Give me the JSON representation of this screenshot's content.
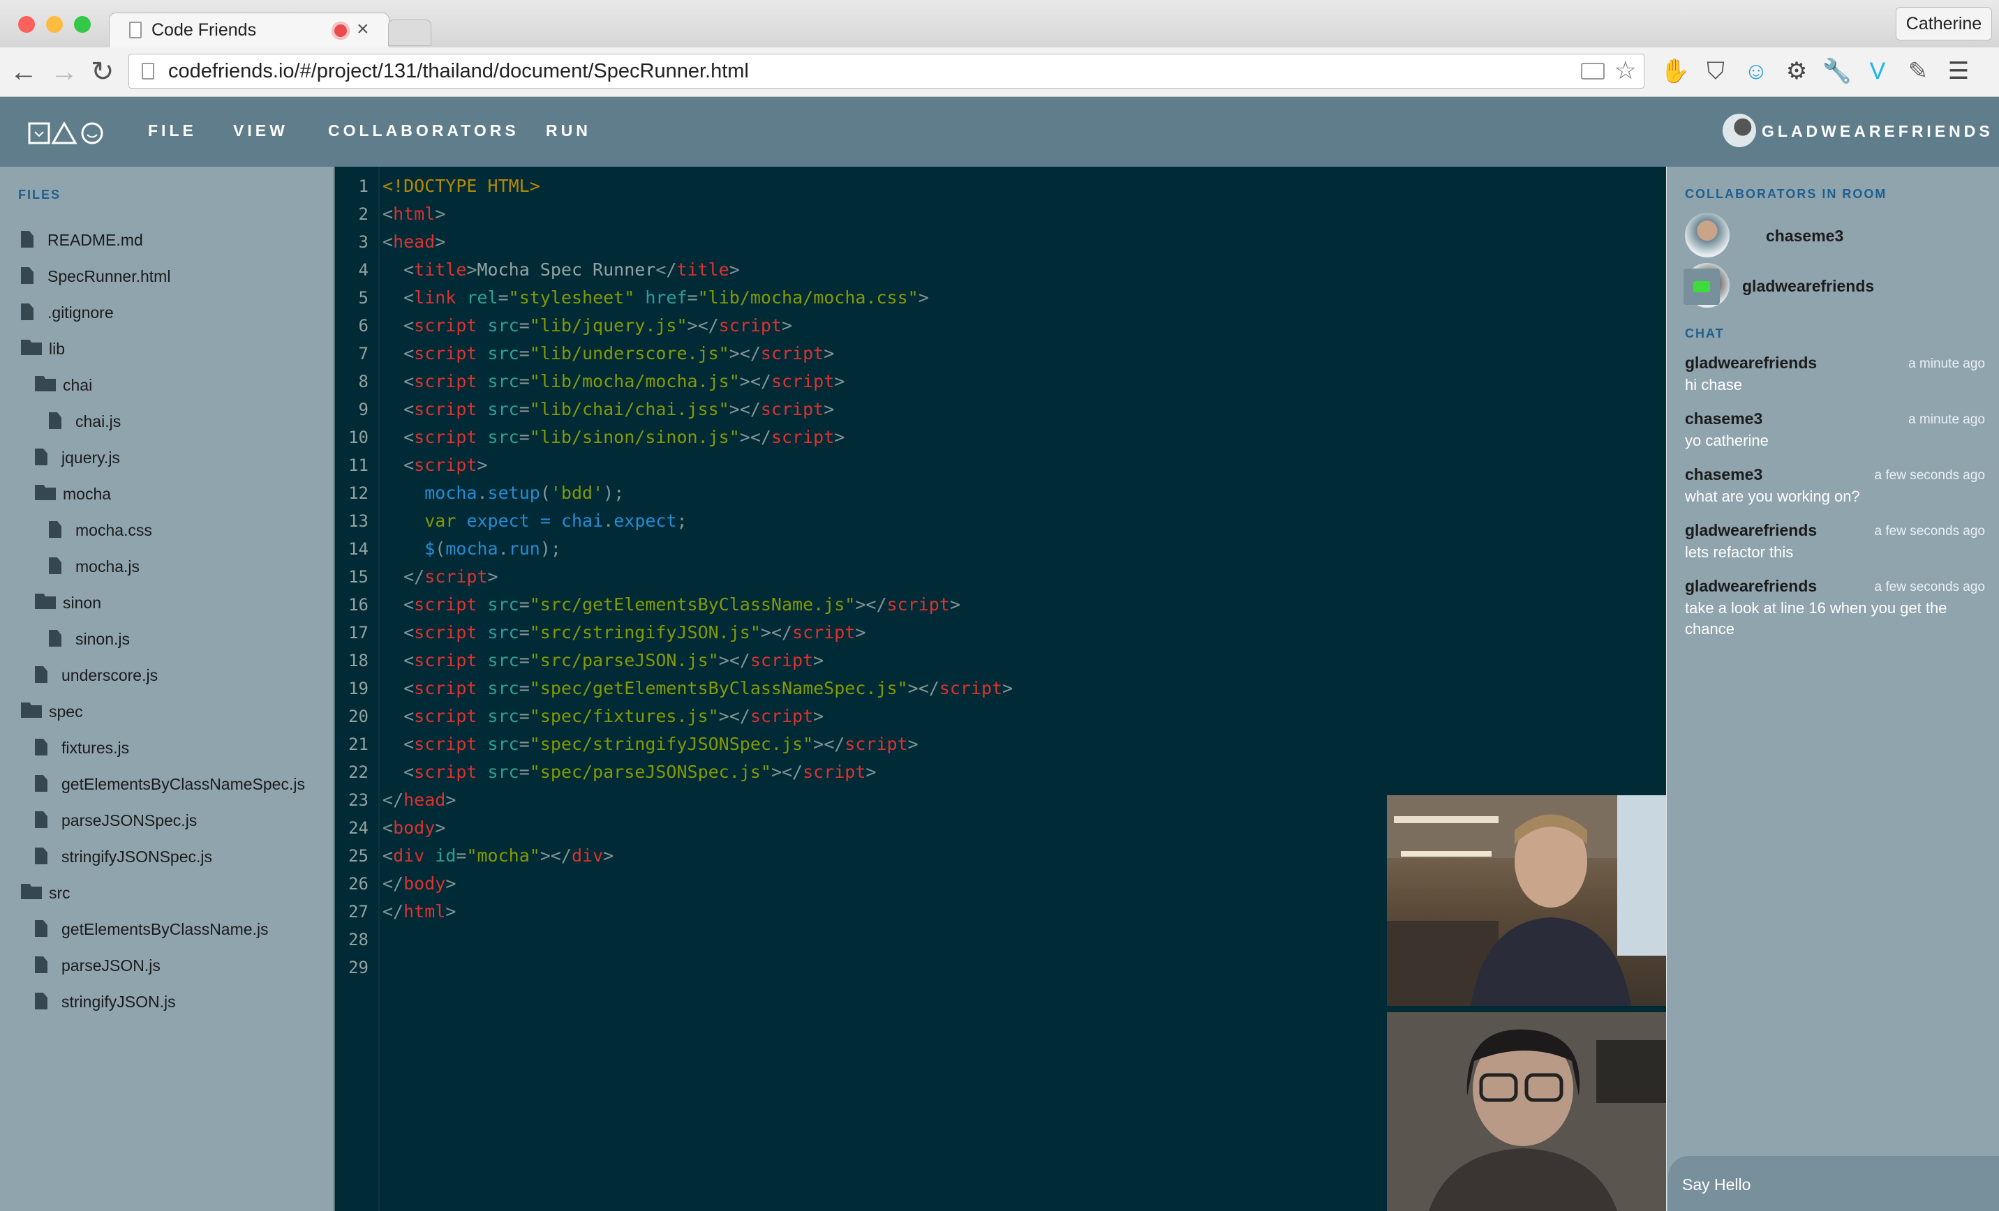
{
  "browser": {
    "tab_title": "Code Friends",
    "profile_name": "Catherine",
    "url": "codefriends.io/#/project/131/thailand/document/SpecRunner.html",
    "traffic_lights": [
      "#fc605c",
      "#fdbc40",
      "#34c84a"
    ],
    "nav_icons": [
      "back-arrow-icon",
      "forward-arrow-icon",
      "reload-icon"
    ],
    "extensions": [
      {
        "name": "adblock-icon",
        "glyph": "✋",
        "color": "#d8302c"
      },
      {
        "name": "pocket-icon",
        "glyph": "⛉",
        "color": "#555"
      },
      {
        "name": "ghost-icon",
        "glyph": "☺",
        "color": "#2e9bdc"
      },
      {
        "name": "settings-gear-icon",
        "glyph": "⚙",
        "color": "#444"
      },
      {
        "name": "wrench-icon",
        "glyph": "🔧",
        "color": "#444"
      },
      {
        "name": "vimeo-icon",
        "glyph": "V",
        "color": "#1ab7ea"
      },
      {
        "name": "eyedropper-icon",
        "glyph": "✎",
        "color": "#666"
      },
      {
        "name": "hamburger-menu-icon",
        "glyph": "☰",
        "color": "#444"
      }
    ]
  },
  "app": {
    "menu": [
      "FILE",
      "VIEW",
      "COLLABORATORS",
      "RUN"
    ],
    "user_name": "GLADWEAREFRIENDS",
    "accent": "#607d8b"
  },
  "files": {
    "header": "FILES",
    "items": [
      {
        "type": "file",
        "depth": 0,
        "name": "README.md"
      },
      {
        "type": "file",
        "depth": 0,
        "name": "SpecRunner.html"
      },
      {
        "type": "file",
        "depth": 0,
        "name": ".gitignore"
      },
      {
        "type": "folder",
        "depth": 0,
        "name": "lib"
      },
      {
        "type": "folder",
        "depth": 1,
        "name": "chai"
      },
      {
        "type": "file",
        "depth": 2,
        "name": "chai.js"
      },
      {
        "type": "file",
        "depth": 1,
        "name": "jquery.js"
      },
      {
        "type": "folder",
        "depth": 1,
        "name": "mocha"
      },
      {
        "type": "file",
        "depth": 2,
        "name": "mocha.css"
      },
      {
        "type": "file",
        "depth": 2,
        "name": "mocha.js"
      },
      {
        "type": "folder",
        "depth": 1,
        "name": "sinon"
      },
      {
        "type": "file",
        "depth": 2,
        "name": "sinon.js"
      },
      {
        "type": "file",
        "depth": 1,
        "name": "underscore.js"
      },
      {
        "type": "folder",
        "depth": 0,
        "name": "spec"
      },
      {
        "type": "file",
        "depth": 1,
        "name": "fixtures.js"
      },
      {
        "type": "file",
        "depth": 1,
        "name": "getElementsByClassNameSpec.js"
      },
      {
        "type": "file",
        "depth": 1,
        "name": "parseJSONSpec.js"
      },
      {
        "type": "file",
        "depth": 1,
        "name": "stringifyJSONSpec.js"
      },
      {
        "type": "folder",
        "depth": 0,
        "name": "src"
      },
      {
        "type": "file",
        "depth": 1,
        "name": "getElementsByClassName.js"
      },
      {
        "type": "file",
        "depth": 1,
        "name": "parseJSON.js"
      },
      {
        "type": "file",
        "depth": 1,
        "name": "stringifyJSON.js"
      }
    ]
  },
  "editor": {
    "line_count": 29,
    "lines": [
      [
        [
          "dt",
          "<!DOCTYPE HTML>"
        ]
      ],
      [
        [
          "p",
          "<"
        ],
        [
          "tag",
          "html"
        ],
        [
          "p",
          ">"
        ]
      ],
      [
        [
          "p",
          "<"
        ],
        [
          "tag",
          "head"
        ],
        [
          "p",
          ">"
        ]
      ],
      [
        [
          "p",
          "  <"
        ],
        [
          "tag",
          "title"
        ],
        [
          "p",
          ">"
        ],
        [
          "txt",
          "Mocha Spec Runner"
        ],
        [
          "p",
          "</"
        ],
        [
          "tag",
          "title"
        ],
        [
          "p",
          ">"
        ]
      ],
      [
        [
          "p",
          "  <"
        ],
        [
          "tag",
          "link"
        ],
        [
          "p",
          " "
        ],
        [
          "attr",
          "rel"
        ],
        [
          "p",
          "="
        ],
        [
          "str",
          "\"stylesheet\""
        ],
        [
          "p",
          " "
        ],
        [
          "attr",
          "href"
        ],
        [
          "p",
          "="
        ],
        [
          "str",
          "\"lib/mocha/mocha.css\""
        ],
        [
          "p",
          ">"
        ]
      ],
      [
        [
          "p",
          "  <"
        ],
        [
          "tag",
          "script"
        ],
        [
          "p",
          " "
        ],
        [
          "attr",
          "src"
        ],
        [
          "p",
          "="
        ],
        [
          "str",
          "\"lib/jquery.js\""
        ],
        [
          "p",
          "></"
        ],
        [
          "tag",
          "script"
        ],
        [
          "p",
          ">"
        ]
      ],
      [
        [
          "p",
          "  <"
        ],
        [
          "tag",
          "script"
        ],
        [
          "p",
          " "
        ],
        [
          "attr",
          "src"
        ],
        [
          "p",
          "="
        ],
        [
          "str",
          "\"lib/underscore.js\""
        ],
        [
          "p",
          "></"
        ],
        [
          "tag",
          "script"
        ],
        [
          "p",
          ">"
        ]
      ],
      [
        [
          "p",
          "  <"
        ],
        [
          "tag",
          "script"
        ],
        [
          "p",
          " "
        ],
        [
          "attr",
          "src"
        ],
        [
          "p",
          "="
        ],
        [
          "str",
          "\"lib/mocha/mocha.js\""
        ],
        [
          "p",
          "></"
        ],
        [
          "tag",
          "script"
        ],
        [
          "p",
          ">"
        ]
      ],
      [
        [
          "p",
          "  <"
        ],
        [
          "tag",
          "script"
        ],
        [
          "p",
          " "
        ],
        [
          "attr",
          "src"
        ],
        [
          "p",
          "="
        ],
        [
          "str",
          "\"lib/chai/chai.jss\""
        ],
        [
          "p",
          "></"
        ],
        [
          "tag",
          "script"
        ],
        [
          "p",
          ">"
        ]
      ],
      [
        [
          "p",
          "  <"
        ],
        [
          "tag",
          "script"
        ],
        [
          "p",
          " "
        ],
        [
          "attr",
          "src"
        ],
        [
          "p",
          "="
        ],
        [
          "str",
          "\"lib/sinon/sinon.js\""
        ],
        [
          "p",
          "></"
        ],
        [
          "tag",
          "script"
        ],
        [
          "p",
          ">"
        ]
      ],
      [
        [
          "p",
          "  <"
        ],
        [
          "tag",
          "script"
        ],
        [
          "p",
          ">"
        ]
      ],
      [
        [
          "p",
          "    "
        ],
        [
          "id",
          "mocha"
        ],
        [
          "p",
          "."
        ],
        [
          "id",
          "setup"
        ],
        [
          "p",
          "("
        ],
        [
          "str",
          "'bdd'"
        ],
        [
          "p",
          ");"
        ]
      ],
      [
        [
          "p",
          "    "
        ],
        [
          "kw",
          "var"
        ],
        [
          "p",
          " "
        ],
        [
          "id",
          "expect"
        ],
        [
          "p",
          " "
        ],
        [
          "id",
          "="
        ],
        [
          "p",
          " "
        ],
        [
          "id",
          "chai"
        ],
        [
          "p",
          "."
        ],
        [
          "id",
          "expect"
        ],
        [
          "p",
          ";"
        ]
      ],
      [
        [
          "p",
          "    "
        ],
        [
          "id",
          "$"
        ],
        [
          "p",
          "("
        ],
        [
          "id",
          "mocha"
        ],
        [
          "p",
          "."
        ],
        [
          "id",
          "run"
        ],
        [
          "p",
          ");"
        ]
      ],
      [
        [
          "p",
          "  </"
        ],
        [
          "tag",
          "script"
        ],
        [
          "p",
          ">"
        ]
      ],
      [
        [
          "p",
          "  <"
        ],
        [
          "tag",
          "script"
        ],
        [
          "p",
          " "
        ],
        [
          "attr",
          "src"
        ],
        [
          "p",
          "="
        ],
        [
          "str",
          "\"src/getElementsByClassName.js\""
        ],
        [
          "p",
          "></"
        ],
        [
          "tag",
          "script"
        ],
        [
          "p",
          ">"
        ]
      ],
      [
        [
          "p",
          "  <"
        ],
        [
          "tag",
          "script"
        ],
        [
          "p",
          " "
        ],
        [
          "attr",
          "src"
        ],
        [
          "p",
          "="
        ],
        [
          "str",
          "\"src/stringifyJSON.js\""
        ],
        [
          "p",
          "></"
        ],
        [
          "tag",
          "script"
        ],
        [
          "p",
          ">"
        ]
      ],
      [
        [
          "p",
          "  <"
        ],
        [
          "tag",
          "script"
        ],
        [
          "p",
          " "
        ],
        [
          "attr",
          "src"
        ],
        [
          "p",
          "="
        ],
        [
          "str",
          "\"src/parseJSON.js\""
        ],
        [
          "p",
          "></"
        ],
        [
          "tag",
          "script"
        ],
        [
          "p",
          ">"
        ]
      ],
      [
        [
          "p",
          "  <"
        ],
        [
          "tag",
          "script"
        ],
        [
          "p",
          " "
        ],
        [
          "attr",
          "src"
        ],
        [
          "p",
          "="
        ],
        [
          "str",
          "\"spec/getElementsByClassNameSpec.js\""
        ],
        [
          "p",
          "></"
        ],
        [
          "tag",
          "script"
        ],
        [
          "p",
          ">"
        ]
      ],
      [
        [
          "p",
          "  <"
        ],
        [
          "tag",
          "script"
        ],
        [
          "p",
          " "
        ],
        [
          "attr",
          "src"
        ],
        [
          "p",
          "="
        ],
        [
          "str",
          "\"spec/fixtures.js\""
        ],
        [
          "p",
          "></"
        ],
        [
          "tag",
          "script"
        ],
        [
          "p",
          ">"
        ]
      ],
      [
        [
          "p",
          "  <"
        ],
        [
          "tag",
          "script"
        ],
        [
          "p",
          " "
        ],
        [
          "attr",
          "src"
        ],
        [
          "p",
          "="
        ],
        [
          "str",
          "\"spec/stringifyJSONSpec.js\""
        ],
        [
          "p",
          "></"
        ],
        [
          "tag",
          "script"
        ],
        [
          "p",
          ">"
        ]
      ],
      [
        [
          "p",
          "  <"
        ],
        [
          "tag",
          "script"
        ],
        [
          "p",
          " "
        ],
        [
          "attr",
          "src"
        ],
        [
          "p",
          "="
        ],
        [
          "str",
          "\"spec/parseJSONSpec.js\""
        ],
        [
          "p",
          "></"
        ],
        [
          "tag",
          "script"
        ],
        [
          "p",
          ">"
        ]
      ],
      [
        [
          "p",
          "</"
        ],
        [
          "tag",
          "head"
        ],
        [
          "p",
          ">"
        ]
      ],
      [
        [
          "p",
          "<"
        ],
        [
          "tag",
          "body"
        ],
        [
          "p",
          ">"
        ]
      ],
      [
        [
          "p",
          "<"
        ],
        [
          "tag",
          "div"
        ],
        [
          "p",
          " "
        ],
        [
          "attr",
          "id"
        ],
        [
          "p",
          "="
        ],
        [
          "str",
          "\"mocha\""
        ],
        [
          "p",
          "></"
        ],
        [
          "tag",
          "div"
        ],
        [
          "p",
          ">"
        ]
      ],
      [
        [
          "p",
          "</"
        ],
        [
          "tag",
          "body"
        ],
        [
          "p",
          ">"
        ]
      ],
      [
        [
          "p",
          "</"
        ],
        [
          "tag",
          "html"
        ],
        [
          "p",
          ">"
        ]
      ],
      [],
      []
    ]
  },
  "collaborators": {
    "header": "COLLABORATORS IN ROOM",
    "users": [
      "chaseme3",
      "gladwearefriends"
    ]
  },
  "chat": {
    "header": "CHAT",
    "messages": [
      {
        "author": "gladwearefriends",
        "time": "a minute ago",
        "text": "hi chase"
      },
      {
        "author": "chaseme3",
        "time": "a minute ago",
        "text": "yo catherine"
      },
      {
        "author": "chaseme3",
        "time": "a few seconds ago",
        "text": "what are you working on?"
      },
      {
        "author": "gladwearefriends",
        "time": "a few seconds ago",
        "text": "lets refactor this"
      },
      {
        "author": "gladwearefriends",
        "time": "a few seconds ago",
        "text": "take a look at line 16 when you get the chance"
      }
    ],
    "input_placeholder": "Say Hello"
  }
}
